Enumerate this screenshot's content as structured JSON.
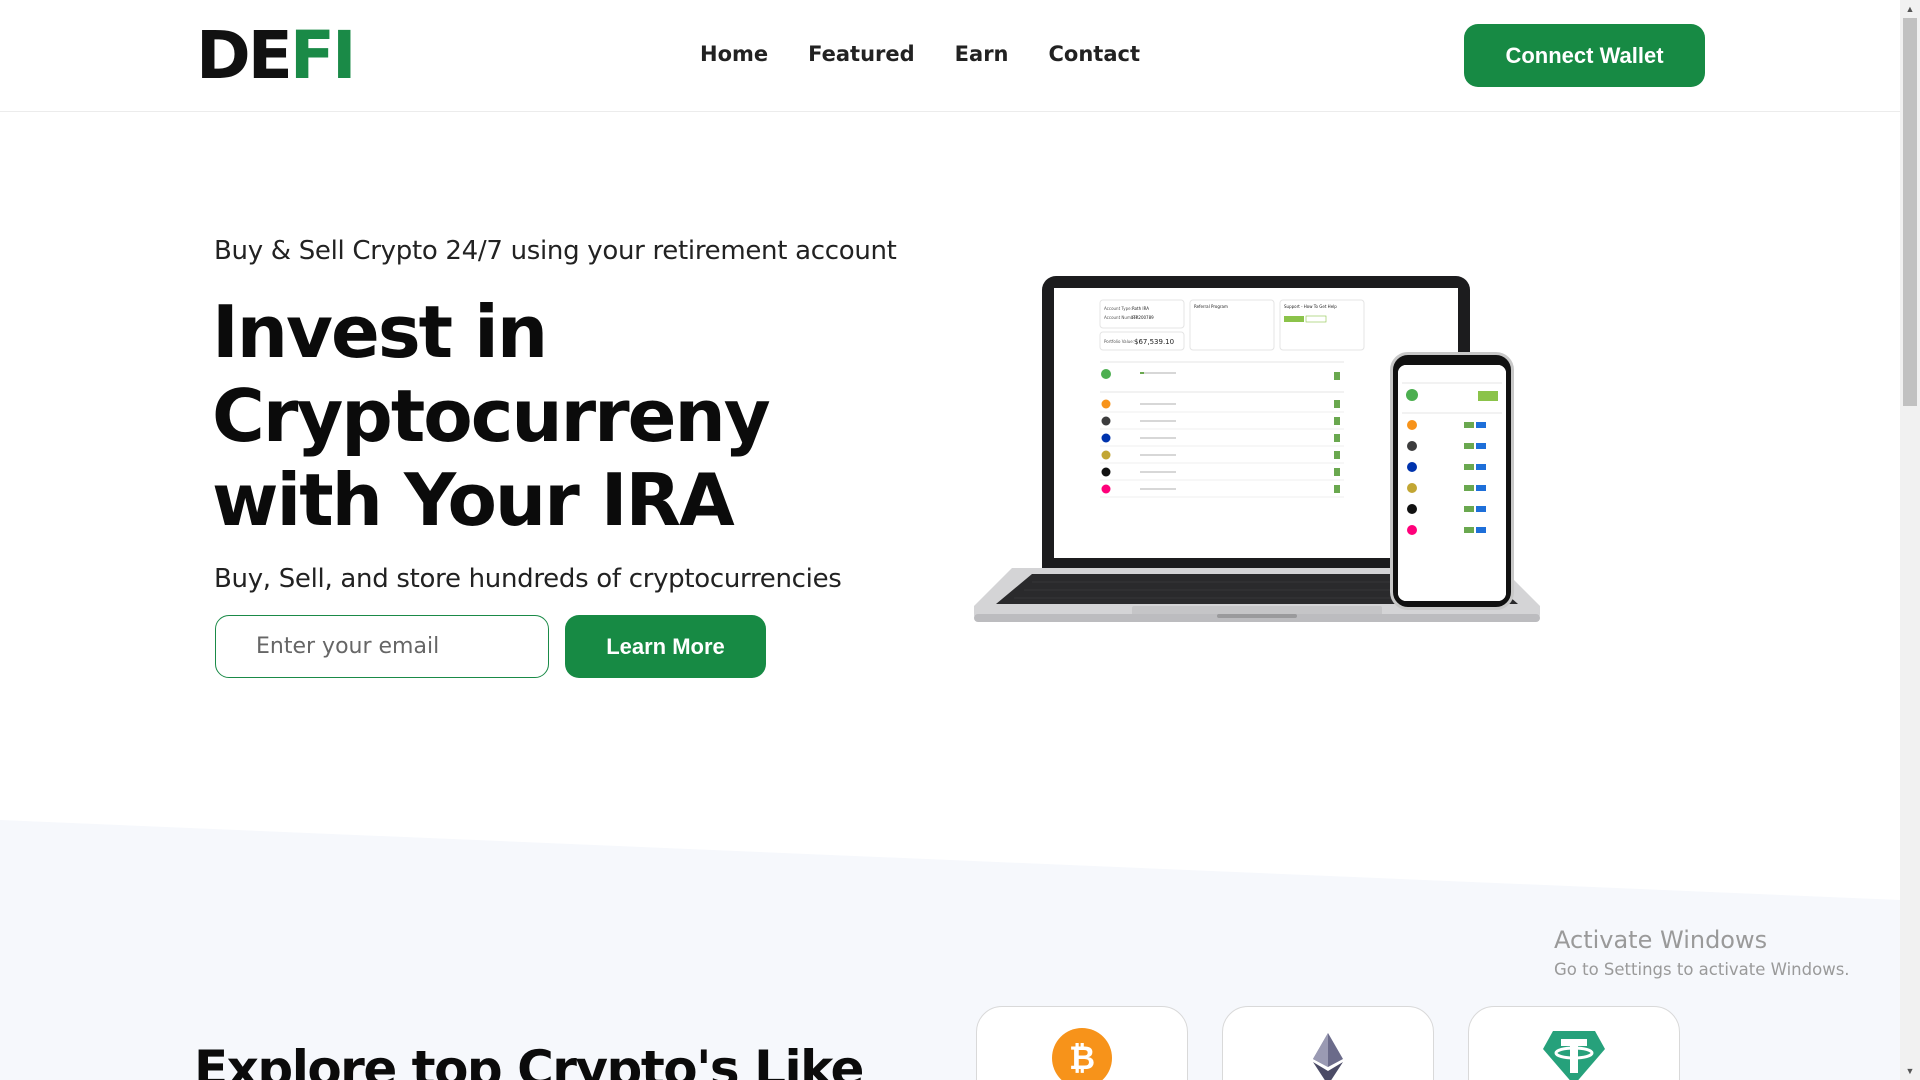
{
  "brand": {
    "part1": "DE",
    "part2": "FI",
    "accent": "#1a8a47"
  },
  "nav": {
    "items": [
      {
        "label": "Home"
      },
      {
        "label": "Featured"
      },
      {
        "label": "Earn"
      },
      {
        "label": "Contact"
      }
    ],
    "cta_label": "Connect Wallet"
  },
  "hero": {
    "subtitle": "Buy & Sell Crypto 24/7 using your retirement account",
    "title": "Invest in Cryptocurreny with Your IRA",
    "description": "Buy, Sell, and store hundreds of cryptocurrencies",
    "email_placeholder": "Enter your email",
    "cta_label": "Learn More"
  },
  "devices": {
    "laptop_screen": {
      "account_type_label": "Account Type:",
      "account_type_value": "Roth IRA",
      "account_number_label": "Account Number:",
      "account_number_value": "ITR200789",
      "portfolio_label": "Portfolio Value:",
      "portfolio_value": "$67,539.10",
      "referral_title": "Referral Program",
      "support_title": "Support - How To Get Help"
    },
    "coins": [
      "Bitcoin",
      "Ethereum",
      "Cardano",
      "Dogecoin",
      "Polkadot",
      "Uniswap"
    ]
  },
  "explore": {
    "title": "Explore top Crypto's Like",
    "coins": [
      {
        "name": "bitcoin-icon",
        "color": "#f7931a"
      },
      {
        "name": "ethereum-icon",
        "color": "#3c3c3d"
      },
      {
        "name": "tether-icon",
        "color": "#26a17b"
      }
    ]
  },
  "watermark": {
    "line1": "Activate Windows",
    "line2": "Go to Settings to activate Windows."
  }
}
